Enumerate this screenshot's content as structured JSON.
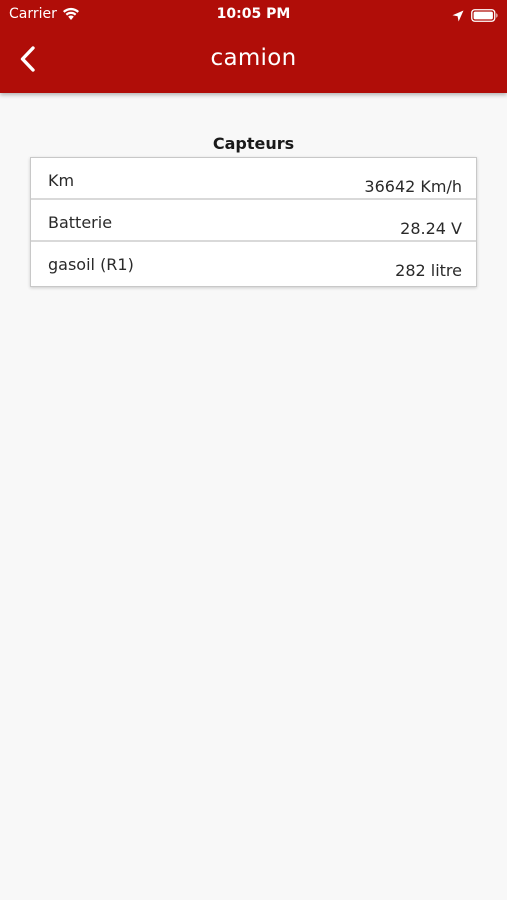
{
  "status_bar": {
    "carrier": "Carrier",
    "time": "10:05 PM",
    "icons": [
      "wifi-icon",
      "location-arrow-icon",
      "battery-icon"
    ]
  },
  "nav": {
    "title": "camion",
    "back_icon": "chevron-left-icon"
  },
  "section": {
    "title": "Capteurs"
  },
  "sensors": [
    {
      "label": "Km",
      "value": "36642 Km/h"
    },
    {
      "label": "Batterie",
      "value": "28.24 V"
    },
    {
      "label": "gasoil (R1)",
      "value": "282 litre"
    }
  ],
  "colors": {
    "header": "#b00d08",
    "background": "#f8f8f8",
    "card": "#ffffff",
    "text": "#2a2a2a"
  }
}
